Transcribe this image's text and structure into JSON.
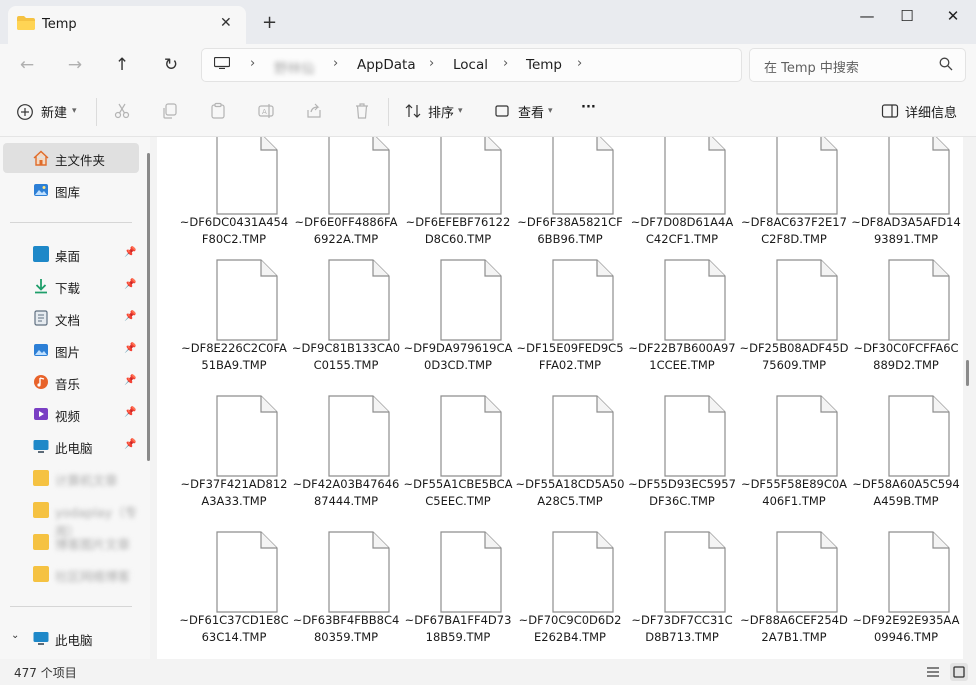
{
  "tab": {
    "title": "Temp",
    "close": "✕",
    "new_tab": "+"
  },
  "window": {
    "minimize": "—",
    "maximize": "☐",
    "close": "✕"
  },
  "nav": {
    "back": "←",
    "forward": "→",
    "up": "↑",
    "refresh": "↻"
  },
  "address": {
    "crumbs": [
      "野林仙",
      "AppData",
      "Local",
      "Temp"
    ],
    "chevron": "›"
  },
  "search": {
    "placeholder": "在 Temp 中搜索"
  },
  "toolbar": {
    "new_label": "新建",
    "sort_label": "排序",
    "view_label": "查看",
    "more_label": "···",
    "details_label": "详细信息"
  },
  "sidebar": {
    "home": "主文件夹",
    "gallery": "图库",
    "quick": [
      {
        "label": "桌面",
        "color": "#1e88c8"
      },
      {
        "label": "下载",
        "color": "#1e9e6a"
      },
      {
        "label": "文档",
        "color": "#5f6f80"
      },
      {
        "label": "图片",
        "color": "#2c7fd6"
      },
      {
        "label": "音乐",
        "color": "#e8632b"
      },
      {
        "label": "视频",
        "color": "#7a3fc4"
      },
      {
        "label": "此电脑",
        "color": "#1e88c8"
      }
    ],
    "blurred": [
      "计算机文章",
      "yodaplay（专用）",
      "博客图片文章",
      "社区网络博客"
    ],
    "this_pc": "此电脑",
    "pin": "📌"
  },
  "files": [
    "~DF6DC0431A454F80C2.TMP",
    "~DF6E0FF4886FA6922A.TMP",
    "~DF6EFEBF76122D8C60.TMP",
    "~DF6F38A5821CF6BB96.TMP",
    "~DF7D08D61A4AC42CF1.TMP",
    "~DF8AC637F2E17C2F8D.TMP",
    "~DF8AD3A5AFD1493891.TMP",
    "~DF8E226C2C0FA51BA9.TMP",
    "~DF9C81B133CA0C0155.TMP",
    "~DF9DA979619CA0D3CD.TMP",
    "~DF15E09FED9C5FFA02.TMP",
    "~DF22B7B600A971CCEE.TMP",
    "~DF25B08ADF45D75609.TMP",
    "~DF30C0FCFFA6C889D2.TMP",
    "~DF37F421AD812A3A33.TMP",
    "~DF42A03B4764687444.TMP",
    "~DF55A1CBE5BCAC5EEC.TMP",
    "~DF55A18CD5A50A28C5.TMP",
    "~DF55D93EC5957DF36C.TMP",
    "~DF55F58E89C0A406F1.TMP",
    "~DF58A60A5C594A459B.TMP",
    "~DF61C37CD1E8C63C14.TMP",
    "~DF63BF4FBB8C480359.TMP",
    "~DF67BA1FF4D7318B59.TMP",
    "~DF70C9C0D6D2E262B4.TMP",
    "~DF73DF7CC31CD8B713.TMP",
    "~DF88A6CEF254D2A7B1.TMP",
    "~DF92E92E935AA09946.TMP"
  ],
  "status": {
    "count": "477 个项目"
  }
}
